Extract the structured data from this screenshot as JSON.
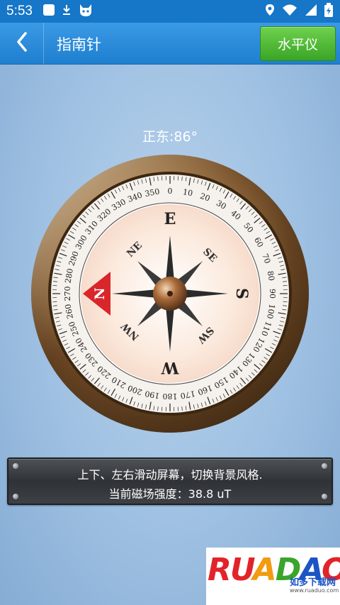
{
  "status_bar": {
    "time": "5:53",
    "left_icons": [
      "app-square-icon",
      "download-icon",
      "android-cat-icon"
    ],
    "right_icons": [
      "location-icon",
      "wifi-icon",
      "signal-icon",
      "battery-charging-icon"
    ]
  },
  "app_bar": {
    "back_icon": "chevron-left-icon",
    "title": "指南针",
    "level_button_label": "水平仪",
    "accent_color": "#1f7fd0",
    "button_color": "#3aa526"
  },
  "compass": {
    "heading_text": "正东:86°",
    "heading_degrees": 86,
    "cardinals": {
      "n": "N",
      "e": "E",
      "s": "S",
      "w": "W"
    },
    "intercardinals": {
      "ne": "NE",
      "se": "SE",
      "sw": "SW",
      "nw": "NW"
    },
    "degree_labels": [
      "0",
      "10",
      "20",
      "30",
      "40",
      "50",
      "60",
      "70",
      "80",
      "90",
      "100",
      "110",
      "120",
      "130",
      "140",
      "150",
      "160",
      "170",
      "180",
      "190",
      "200",
      "210",
      "220",
      "230",
      "240",
      "250",
      "260",
      "270",
      "280",
      "290",
      "300",
      "310",
      "320",
      "330",
      "340",
      "350"
    ],
    "north_marker_color": "#d9262b"
  },
  "info_panel": {
    "line1": "上下、左右滑动屏幕，切换背景风格.",
    "line2": "当前磁场强度：38.8 uT"
  },
  "watermark": {
    "brand": "RUANDAO",
    "subtitle": "如多下载网",
    "url": "www.ruaduo.com"
  }
}
